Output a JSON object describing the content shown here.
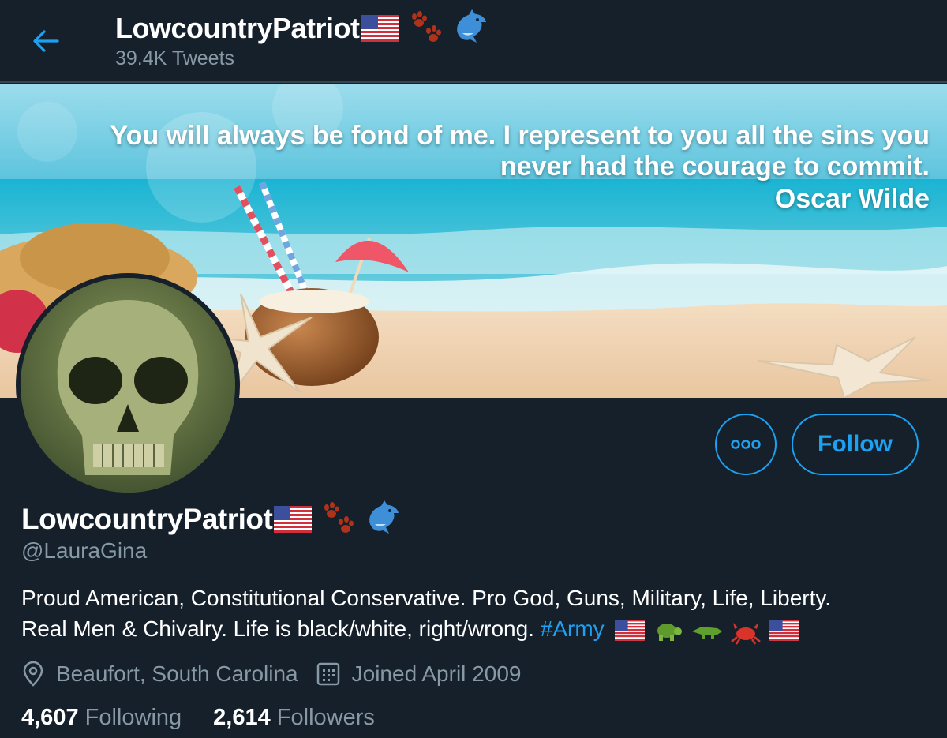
{
  "header": {
    "back_icon": "arrow-left-icon",
    "title": "LowcountryPatriot",
    "tweets_count": "39.4K Tweets"
  },
  "banner": {
    "quote_line1": "You will always be fond of me. I represent to you all the sins you",
    "quote_line2": "never had the courage to commit.",
    "quote_author": "Oscar Wilde"
  },
  "actions": {
    "more_icon": "more-options-icon",
    "follow_label": "Follow"
  },
  "profile": {
    "display_name": "LowcountryPatriot",
    "name_emojis": [
      "flag-us-icon",
      "paw-prints-icon",
      "dolphin-icon"
    ],
    "handle": "@LauraGina",
    "bio_line1": "Proud American, Constitutional Conservative. Pro God, Guns, Military, Life, Liberty.",
    "bio_line2": "Real Men & Chivalry. Life is black/white, right/wrong.",
    "hashtag": "#Army",
    "bio_emojis": [
      "flag-us-icon",
      "turtle-icon",
      "crocodile-icon",
      "crab-icon",
      "flag-us-icon"
    ],
    "location": "Beaufort, South Carolina",
    "joined": "Joined April 2009",
    "following_count": "4,607",
    "following_label": "Following",
    "followers_count": "2,614",
    "followers_label": "Followers"
  },
  "colors": {
    "background": "#15202b",
    "accent": "#1da1f2",
    "secondary_text": "#8899a6",
    "divider": "#38444d"
  }
}
